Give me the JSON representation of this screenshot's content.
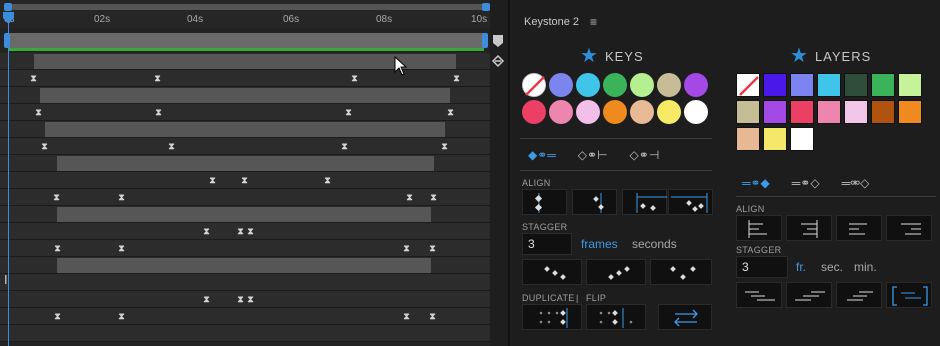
{
  "timeline": {
    "ticks": [
      "0s",
      "02s",
      "04s",
      "06s",
      "08s",
      "10s"
    ],
    "ibeam": "I"
  },
  "panel": {
    "title": "Keystone 2",
    "menu_icon": "hamburger-icon",
    "keys": {
      "heading": "KEYS",
      "swatches": [
        "none",
        "#7c84ee",
        "#3fc4ea",
        "#3bb35a",
        "#b6ef92",
        "#c6bc95",
        "#a448e6",
        "#ec3f64",
        "#ee85ae",
        "#f1bfe8",
        "#ee8a1e",
        "#e7b994",
        "#f6ea66",
        "#ffffff"
      ],
      "modes": [
        "◆⚭═",
        "◇⚭⊢",
        "◇⚭⊣"
      ],
      "align_label": "ALIGN",
      "stagger_label": "STAGGER",
      "stagger_value": "3",
      "frames_label": "frames",
      "seconds_label": "seconds",
      "duplicate_label": "DUPLICATE",
      "separator": "|",
      "flip_label": "FLIP"
    },
    "layers": {
      "heading": "LAYERS",
      "swatches": [
        "none",
        "#4a18e8",
        "#7a83f0",
        "#3fc4ea",
        "#2f4d3b",
        "#3bb35a",
        "#c6f29a",
        "#c4bc94",
        "#a448e6",
        "#ec3f64",
        "#ee85ae",
        "#f2c6e8",
        "#b0530e",
        "#ee8a1e",
        "#e6b994",
        "#f5e76a",
        "#ffffff"
      ],
      "modes": [
        "═⚭◆",
        "═⚭◇",
        "═⚮◇"
      ],
      "align_label": "ALIGN",
      "stagger_label": "STAGGER",
      "stagger_value": "3",
      "fr_label": "fr.",
      "sec_label": "sec.",
      "min_label": "min."
    }
  }
}
